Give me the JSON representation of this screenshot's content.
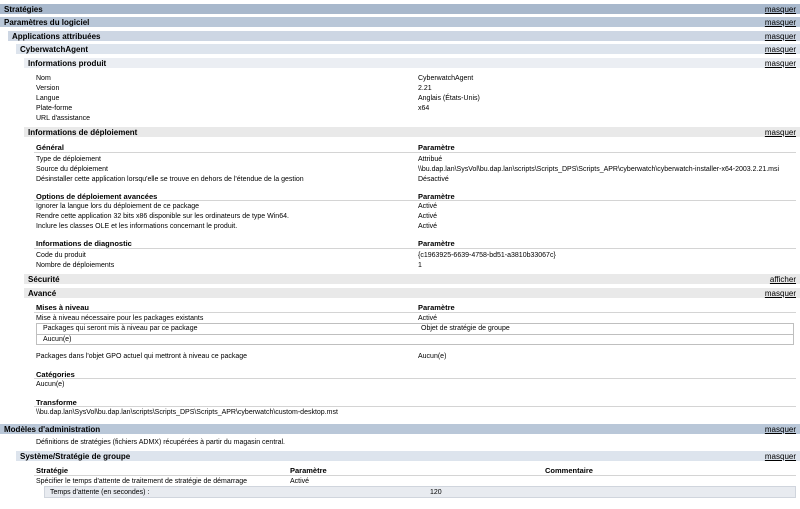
{
  "strategies": {
    "title": "Stratégies",
    "link": "masquer"
  },
  "software": {
    "title": "Paramètres du logiciel",
    "link": "masquer"
  },
  "assigned": {
    "title": "Applications attribuées",
    "link": "masquer"
  },
  "agent": {
    "title": "CyberwatchAgent",
    "link": "masquer"
  },
  "product": {
    "title": "Informations produit",
    "link": "masquer",
    "rows": [
      {
        "label": "Nom",
        "value": "CyberwatchAgent"
      },
      {
        "label": "Version",
        "value": "2.21"
      },
      {
        "label": "Langue",
        "value": "Anglais (États-Unis)"
      },
      {
        "label": "Plate-forme",
        "value": "x64"
      },
      {
        "label": "URL d'assistance",
        "value": ""
      }
    ]
  },
  "deploy": {
    "title": "Informations de déploiement",
    "link": "masquer",
    "general_h": "Général",
    "param_h": "Paramètre",
    "general_rows": [
      {
        "label": "Type de déploiement",
        "value": "Attribué"
      },
      {
        "label": "Source du déploiement",
        "value": "\\\\bu.dap.lan\\SysVol\\bu.dap.lan\\scripts\\Scripts_DPS\\Scripts_APR\\cyberwatch\\cyberwatch-installer-x64-2003.2.21.msi"
      },
      {
        "label": "Désinstaller cette application lorsqu'elle se trouve en dehors de l'étendue de la gestion",
        "value": "Désactivé"
      }
    ],
    "adv_h": "Options de déploiement avancées",
    "adv_rows": [
      {
        "label": "Ignorer la langue lors du déploiement de ce package",
        "value": "Activé"
      },
      {
        "label": "Rendre cette application 32 bits x86 disponible sur les ordinateurs de type Win64.",
        "value": "Activé"
      },
      {
        "label": "Inclure les classes OLE et les informations concernant le produit.",
        "value": "Activé"
      }
    ],
    "diag_h": "Informations de diagnostic",
    "diag_rows": [
      {
        "label": "Code du produit",
        "value": "{c1963925-6639-4758-bd51-a3810b33067c}"
      },
      {
        "label": "Nombre de déploiements",
        "value": "1"
      }
    ]
  },
  "security": {
    "title": "Sécurité",
    "link": "afficher"
  },
  "advanced": {
    "title": "Avancé",
    "link": "masquer",
    "upgrades_h": "Mises à niveau",
    "param_h": "Paramètre",
    "upgrade_required": {
      "label": "Mise à niveau nécessaire pour les packages existants",
      "value": "Activé"
    },
    "table_col1": "Packages qui seront mis à niveau par ce package",
    "table_col2": "Objet de stratégie de groupe",
    "table_empty": "Aucun(e)",
    "gpo_row": {
      "label": "Packages dans l'objet GPO actuel qui mettront à niveau ce package",
      "value": "Aucun(e)"
    },
    "categories_h": "Catégories",
    "categories_val": "Aucun(e)",
    "transform_h": "Transforme",
    "transform_val": "\\\\bu.dap.lan\\SysVol\\bu.dap.lan\\scripts\\Scripts_DPS\\Scripts_APR\\cyberwatch\\custom-desktop.mst"
  },
  "admin": {
    "title": "Modèles d'administration",
    "link": "masquer",
    "desc": "Définitions de stratégies (fichiers ADMX) récupérées à partir du magasin central."
  },
  "system": {
    "title": "Système/Stratégie de groupe",
    "link": "masquer",
    "col_policy": "Stratégie",
    "col_param": "Paramètre",
    "col_comment": "Commentaire",
    "row_label": "Spécifier le temps d'attente de traitement de stratégie de démarrage",
    "row_value": "Activé",
    "wait_label": "Temps d'attente (en secondes) :",
    "wait_value": "120"
  }
}
